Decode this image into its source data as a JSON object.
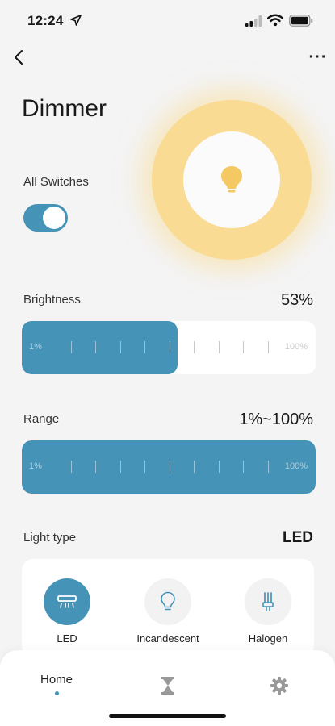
{
  "status_bar": {
    "time": "12:24"
  },
  "header": {
    "title": "Dimmer",
    "more_label": "···"
  },
  "all_switches": {
    "label": "All Switches",
    "on": true
  },
  "brightness": {
    "label": "Brightness",
    "value_text": "53%",
    "value": 0.53,
    "min_label": "1%",
    "max_label": "100%"
  },
  "range": {
    "label": "Range",
    "value_text": "1%~100%",
    "min_label": "1%",
    "max_label": "100%"
  },
  "light_type": {
    "label": "Light type",
    "value_text": "LED",
    "options": [
      {
        "label": "LED",
        "icon": "led-strip-icon",
        "selected": true
      },
      {
        "label": "Incandescent",
        "icon": "bulb-icon",
        "selected": false
      },
      {
        "label": "Halogen",
        "icon": "halogen-icon",
        "selected": false
      }
    ]
  },
  "tabbar": {
    "home_label": "Home",
    "scenes_icon": "hourglass-icon",
    "settings_icon": "gear-icon"
  },
  "colors": {
    "accent": "#4693b8",
    "bulb_glow": "#f9db93",
    "bulb_icon": "#f4c862"
  }
}
